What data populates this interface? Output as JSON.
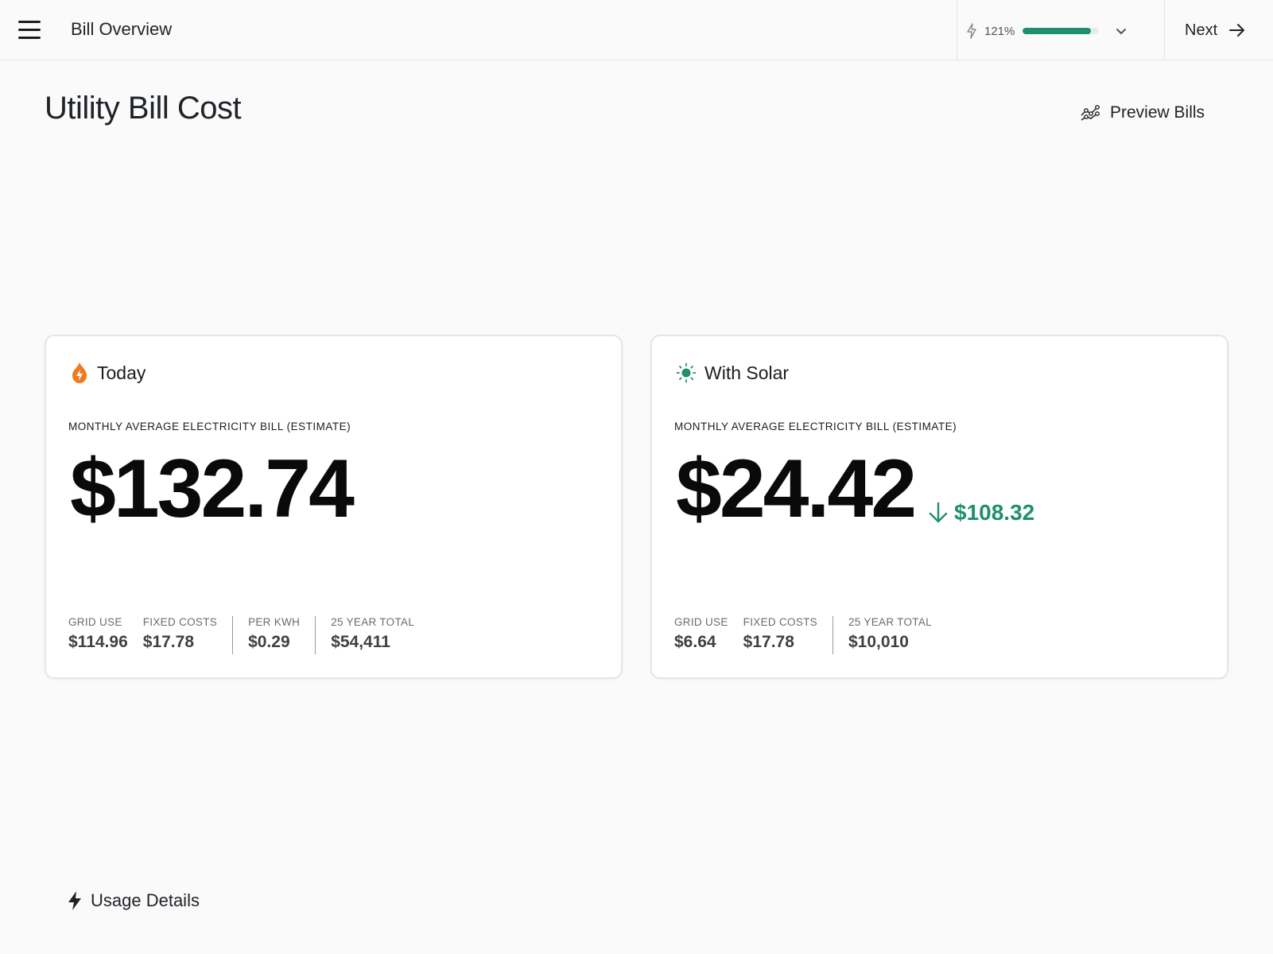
{
  "header": {
    "title": "Bill Overview",
    "progress_text": "121%",
    "progress_fraction": 0.9,
    "next_label": "Next"
  },
  "page": {
    "title": "Utility Bill Cost",
    "preview_label": "Preview Bills"
  },
  "today": {
    "title": "Today",
    "subtitle": "MONTHLY AVERAGE ELECTRICITY BILL (ESTIMATE)",
    "amount": "$132.74",
    "stats": [
      {
        "label": "GRID USE",
        "value": "$114.96"
      },
      {
        "label": "FIXED COSTS",
        "value": "$17.78"
      },
      {
        "label": "PER KWH",
        "value": "$0.29"
      },
      {
        "label": "25 YEAR TOTAL",
        "value": "$54,411"
      }
    ]
  },
  "solar": {
    "title": "With Solar",
    "subtitle": "MONTHLY AVERAGE ELECTRICITY BILL (ESTIMATE)",
    "amount": "$24.42",
    "savings": "$108.32",
    "stats": [
      {
        "label": "GRID USE",
        "value": "$6.64"
      },
      {
        "label": "FIXED COSTS",
        "value": "$17.78"
      },
      {
        "label": "25 YEAR TOTAL",
        "value": "$10,010"
      }
    ]
  },
  "footer": {
    "usage_label": "Usage Details"
  },
  "colors": {
    "accent_green": "#1f8f6f",
    "flame_orange": "#f07a1f"
  },
  "icons": [
    "hamburger-menu-icon",
    "bolt-icon",
    "chevron-down-icon",
    "arrow-right-icon",
    "chart-nodes-icon",
    "flame-icon",
    "sun-icon",
    "arrow-down-icon",
    "lightning-icon"
  ]
}
